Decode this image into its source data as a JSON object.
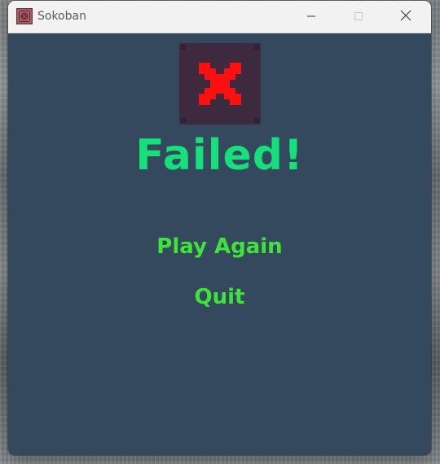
{
  "window": {
    "title": "Sokoban",
    "app_icon": "sokoban-box-icon",
    "controls": {
      "minimize_icon": "minimize-icon",
      "maximize_icon": "maximize-icon",
      "close_icon": "close-icon"
    }
  },
  "game_over": {
    "status_icon": "red-x-icon",
    "heading": "Failed!",
    "menu": [
      {
        "label": "Play Again"
      },
      {
        "label": "Quit"
      }
    ]
  },
  "colors": {
    "background": "#34495e",
    "heading": "#15e07b",
    "menu_text": "#3ee43a",
    "tile": "#3d2a3f",
    "x_mark": "#ff1010"
  }
}
